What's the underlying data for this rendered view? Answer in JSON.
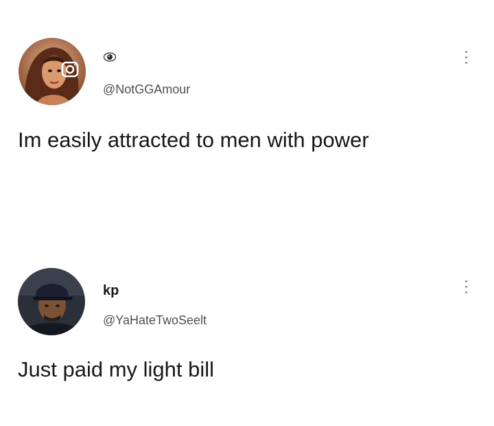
{
  "tweets": [
    {
      "display_name": "",
      "handle": "@NotGGAmour",
      "text": "Im easily attracted to men with power",
      "avatar_icon": "profile-photo-woman",
      "badge_icon": "eye-emoji"
    },
    {
      "display_name": "kp",
      "handle": "@YaHateTwoSeelt",
      "text": "Just paid my light bill",
      "avatar_icon": "profile-photo-man-cap"
    }
  ],
  "colors": {
    "text_primary": "#14171a",
    "text_secondary": "#4a4f55",
    "background": "#ffffff"
  }
}
